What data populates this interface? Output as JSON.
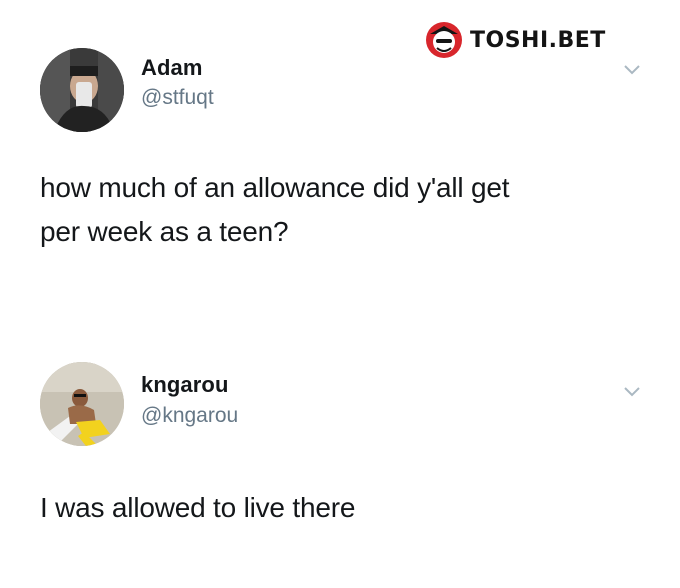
{
  "watermark": {
    "text": "TOSHI.BET",
    "logo_icon": "samurai-mascot-icon"
  },
  "tweets": [
    {
      "name": "Adam",
      "handle": "@stfuqt",
      "text_lines": [
        "how much of an allowance did y'all get",
        "per week as a teen?"
      ],
      "menu_icon": "chevron-down-icon"
    },
    {
      "name": "kngarou",
      "handle": "@kngarou",
      "text_lines": [
        "I was allowed to live there"
      ],
      "menu_icon": "chevron-down-icon"
    }
  ],
  "colors": {
    "name": "#14171a",
    "handle": "#657786",
    "chevron": "#aab8c2",
    "brand_red": "#d8262c"
  }
}
